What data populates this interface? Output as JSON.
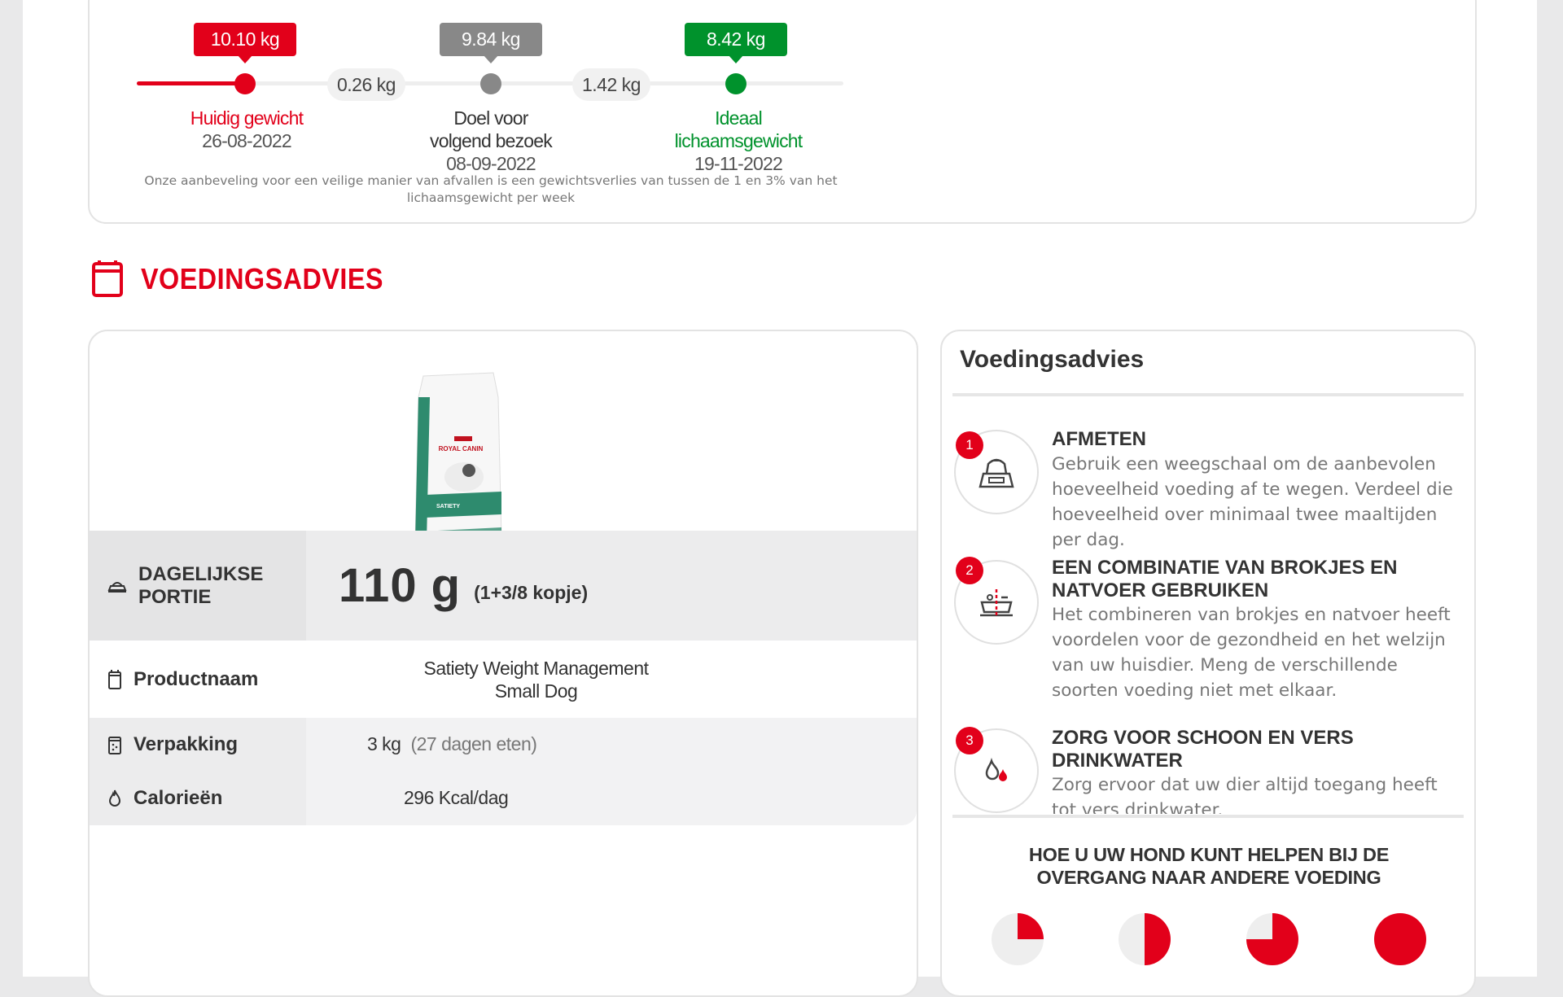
{
  "weight": {
    "current": {
      "bubble": "10.10 kg",
      "label": "Huidig gewicht",
      "date": "26-08-2022"
    },
    "diff1": "0.26 kg",
    "goal": {
      "bubble": "9.84 kg",
      "label_line1": "Doel voor",
      "label_line2": "volgend bezoek",
      "date": "08-09-2022"
    },
    "diff2": "1.42 kg",
    "ideal": {
      "bubble": "8.42 kg",
      "label_line1": "Ideaal",
      "label_line2": "lichaamsgewicht",
      "date": "19-11-2022"
    },
    "note_line1": "Onze aanbeveling voor een veilige manier van afvallen is een gewichtsverlies van tussen de 1 en 3% van het",
    "note_line2": "lichaamsgewicht per week"
  },
  "section": {
    "title": "VOEDINGSADVIES"
  },
  "product": {
    "brand": "ROYAL CANIN",
    "pack_line1": "SATIETY",
    "daily_label_line1": "DAGELIJKSE",
    "daily_label_line2": "PORTIE",
    "daily_amount": "110 g",
    "daily_cups": "(1+3/8 kopje)",
    "name_label": "Productnaam",
    "name_line1": "Satiety Weight Management",
    "name_line2": "Small Dog",
    "package_label": "Verpakking",
    "package_value": "3 kg",
    "package_days": "(27 dagen eten)",
    "calories_label": "Calorieën",
    "calories_value": "296 Kcal/dag"
  },
  "advice": {
    "title": "Voedingsadvies",
    "steps": [
      {
        "num": "1",
        "heading": "AFMETEN",
        "text": "Gebruik een weegschaal om de aanbevolen hoeveelheid voeding af te wegen. Verdeel die hoeveelheid over minimaal twee maaltijden per dag."
      },
      {
        "num": "2",
        "heading": "EEN COMBINATIE VAN BROKJES EN NATVOER GEBRUIKEN",
        "text": "Het combineren van brokjes en natvoer heeft voordelen voor de gezondheid en het welzijn van uw huisdier. Meng de verschillende soorten voeding niet met elkaar."
      },
      {
        "num": "3",
        "heading": "ZORG VOOR SCHOON EN VERS DRINKWATER",
        "text": "Zorg ervoor dat uw dier altijd toegang heeft tot vers drinkwater."
      }
    ],
    "transition_line1": "HOE U UW HOND KUNT HELPEN BIJ DE",
    "transition_line2": "OVERGANG NAAR ANDERE VOEDING",
    "transition_fractions": [
      0.25,
      0.5,
      0.75,
      1.0
    ]
  },
  "colors": {
    "accent": "#e2001a",
    "goal": "#888888",
    "ideal": "#00922c"
  }
}
